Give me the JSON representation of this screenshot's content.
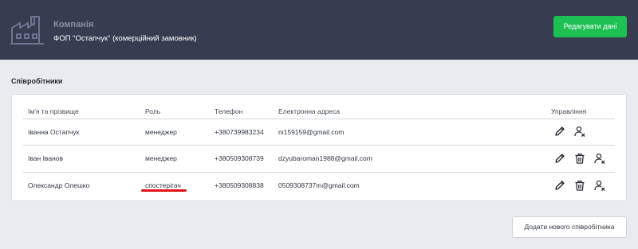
{
  "header": {
    "company_title": "Компанія",
    "company_subtitle": "ФОП \"Остапчук\" (комерційний замовник)",
    "edit_button": "Редагувати дані"
  },
  "section": {
    "title": "Співробітники"
  },
  "table": {
    "columns": [
      "Ім'я та прізвище",
      "Роль",
      "Телефон",
      "Електронна адреса",
      "Управління"
    ],
    "rows": [
      {
        "name": "Іванна Остапчук",
        "role": "менеджер",
        "phone": "+380739983234",
        "email": "ni159159@gmail.com",
        "actions": [
          "edit-icon",
          "remove-user-icon"
        ]
      },
      {
        "name": "Іван Іванов",
        "role": "менеджер",
        "phone": "+380509308739",
        "email": "dzyubaroman1988@gmail.com",
        "actions": [
          "edit-icon",
          "trash-icon",
          "remove-user-icon"
        ]
      },
      {
        "name": "Олександр Олешко",
        "role": "спостерігач",
        "phone": "+380509308838",
        "email": "0509308737m@gmail.com",
        "actions": [
          "edit-icon",
          "trash-icon",
          "remove-user-icon"
        ]
      }
    ]
  },
  "footer": {
    "add_button": "Додати нового співробітника"
  },
  "colors": {
    "header_bg": "#373c50",
    "accent_green": "#1dc153",
    "annotation_red": "#e2121a",
    "page_bg": "#e9ebee"
  }
}
